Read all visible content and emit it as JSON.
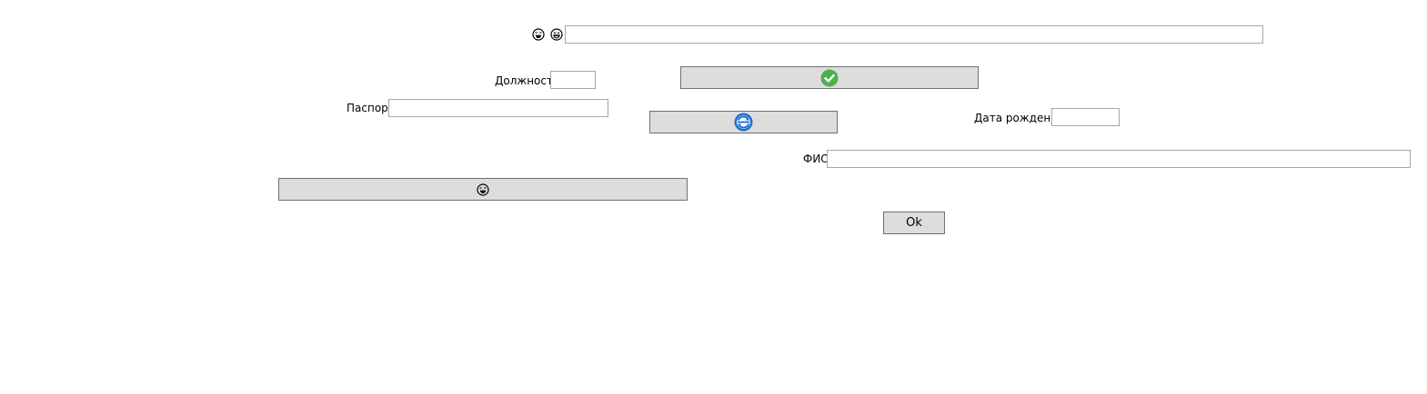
{
  "top_row": {
    "emoji_icons": [
      "laughing-face-icon",
      "grinning-face-icon"
    ],
    "input_value": ""
  },
  "position": {
    "label": "Должность",
    "value": ""
  },
  "passport": {
    "label": "Паспорт",
    "value": ""
  },
  "birth_date": {
    "label": "Дата рождения",
    "value": ""
  },
  "full_name": {
    "label": "ФИО",
    "value": ""
  },
  "buttons": {
    "confirm_icon": "check-circle-icon",
    "refresh_icon": "refresh-circle-icon",
    "emoji_icon": "laughing-face-icon",
    "ok_label": "Ok"
  },
  "colors": {
    "button_bg": "#dddddd",
    "button_border": "#707070",
    "field_border": "#a6a6a6",
    "check_green": "#4caf50",
    "refresh_blue": "#1f6fd1"
  }
}
